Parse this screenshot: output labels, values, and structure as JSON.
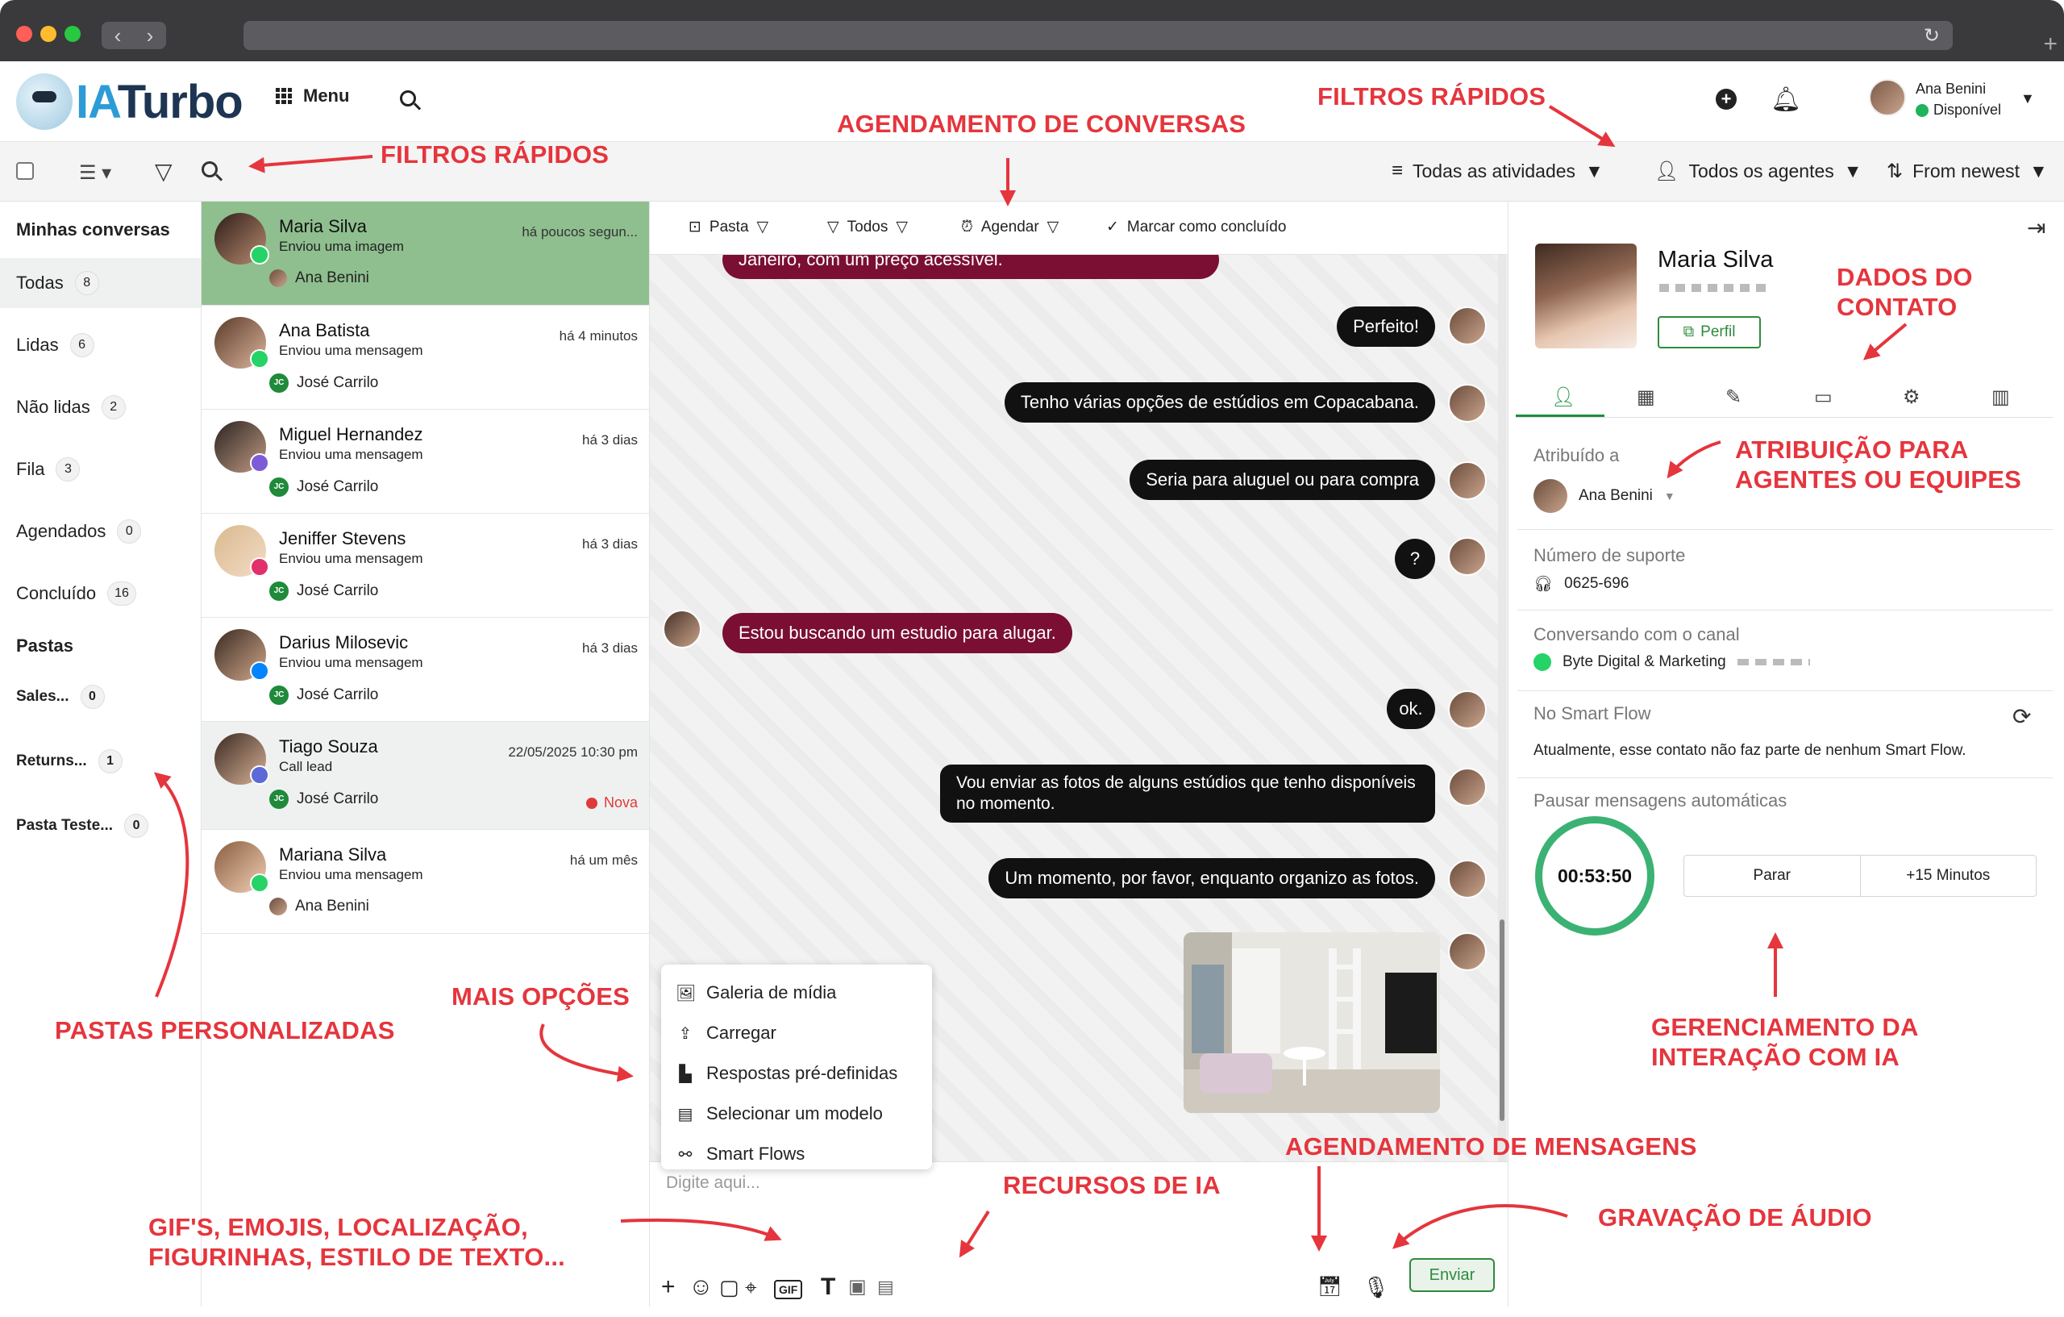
{
  "header": {
    "logo_ia": "IA",
    "logo_turbo": "Turbo",
    "menu_label": "Menu",
    "user_name": "Ana Benini",
    "user_status": "Disponível"
  },
  "toolbar": {
    "activities": "Todas as atividades",
    "agents": "Todos os agentes",
    "sort": "From newest"
  },
  "sidebar": {
    "heading": "Minhas conversas",
    "items": [
      {
        "label": "Todas",
        "count": "8"
      },
      {
        "label": "Lidas",
        "count": "6"
      },
      {
        "label": "Não lidas",
        "count": "2"
      },
      {
        "label": "Fila",
        "count": "3"
      },
      {
        "label": "Agendados",
        "count": "0"
      },
      {
        "label": "Concluído",
        "count": "16"
      }
    ],
    "folders_heading": "Pastas",
    "folders": [
      {
        "label": "Sales...",
        "count": "0"
      },
      {
        "label": "Returns...",
        "count": "1"
      },
      {
        "label": "Pasta Teste...",
        "count": "0"
      }
    ]
  },
  "conversations": [
    {
      "name": "Maria Silva",
      "sub": "Enviou uma imagem",
      "time": "há poucos segun...",
      "agent": "Ana Benini"
    },
    {
      "name": "Ana Batista",
      "sub": "Enviou uma mensagem",
      "time": "há 4 minutos",
      "agent": "José Carrilo"
    },
    {
      "name": "Miguel Hernandez",
      "sub": "Enviou uma mensagem",
      "time": "há 3 dias",
      "agent": "José Carrilo"
    },
    {
      "name": "Jeniffer Stevens",
      "sub": "Enviou uma mensagem",
      "time": "há 3 dias",
      "agent": "José Carrilo"
    },
    {
      "name": "Darius Milosevic",
      "sub": "Enviou uma mensagem",
      "time": "há 3 dias",
      "agent": "José Carrilo"
    },
    {
      "name": "Tiago Souza",
      "sub": "Call lead",
      "time": "22/05/2025 10:30 pm",
      "agent": "José Carrilo",
      "badge": "Nova"
    },
    {
      "name": "Mariana Silva",
      "sub": "Enviou uma mensagem",
      "time": "há um mês",
      "agent": "Ana Benini"
    }
  ],
  "agent_initials": "JC",
  "chat_toolbar": {
    "folder": "Pasta",
    "all": "Todos",
    "schedule": "Agendar",
    "mark_done": "Marcar como concluído"
  },
  "messages": [
    {
      "dir": "in",
      "text": "Janeiro, com um preço acessível."
    },
    {
      "dir": "out",
      "text": "Perfeito!"
    },
    {
      "dir": "out",
      "text": "Tenho várias opções de estúdios em Copacabana."
    },
    {
      "dir": "out",
      "text": "Seria para aluguel ou para compra"
    },
    {
      "dir": "out",
      "text": "?"
    },
    {
      "dir": "in",
      "text": "Estou buscando um estudio para alugar."
    },
    {
      "dir": "out",
      "text": "ok."
    },
    {
      "dir": "out",
      "text": "Vou enviar as fotos de alguns estúdios que tenho disponíveis no momento."
    },
    {
      "dir": "out",
      "text": "Um momento, por favor, enquanto organizo as fotos."
    }
  ],
  "popup": [
    "Galeria de mídia",
    "Carregar",
    "Respostas pré-definidas",
    "Selecionar um modelo",
    "Smart Flows"
  ],
  "composer": {
    "placeholder": "Digite aqui...",
    "send": "Enviar",
    "gif": "GIF"
  },
  "contact": {
    "name": "Maria Silva",
    "profile_btn": "Perfil",
    "assigned_label": "Atribuído a",
    "assigned_value": "Ana Benini",
    "support_label": "Número de suporte",
    "support_value": "0625-696",
    "channel_label": "Conversando com o canal",
    "channel_value": "Byte Digital & Marketing",
    "smartflow_label": "No Smart Flow",
    "smartflow_value": "Atualmente, esse contato não faz parte de nenhum Smart Flow.",
    "pause_label": "Pausar mensagens automáticas",
    "timer": "00:53:50",
    "stop_btn": "Parar",
    "plus_btn": "+15 Minutos"
  },
  "annotations": {
    "filtros_left": "FILTROS RÁPIDOS",
    "agendamento_conversas": "AGENDAMENTO DE CONVERSAS",
    "filtros_right": "FILTROS RÁPIDOS",
    "dados_contato_1": "DADOS DO",
    "dados_contato_2": "CONTATO",
    "atribuicao_1": "ATRIBUIÇÃO PARA",
    "atribuicao_2": "AGENTES OU EQUIPES",
    "pastas": "PASTAS PERSONALIZADAS",
    "mais_opcoes": "MAIS OPÇÕES",
    "gerenciamento_1": "GERENCIAMENTO DA",
    "gerenciamento_2": "INTERAÇÃO COM IA",
    "agendamento_mensagens": "AGENDAMENTO DE MENSAGENS",
    "recursos_ia": "RECURSOS DE IA",
    "gravacao": "GRAVAÇÃO DE ÁUDIO",
    "gifs_1": "GIF'S, EMOJIS, LOCALIZAÇÃO,",
    "gifs_2": "FIGURINHAS, ESTILO DE TEXTO..."
  },
  "colors": {
    "accent_green": "#2e8b3e",
    "active_conv": "#8fbf8f",
    "incoming_bubble": "#7a0f33",
    "outgoing_bubble": "#111111",
    "annotation_red": "#e5353d"
  }
}
